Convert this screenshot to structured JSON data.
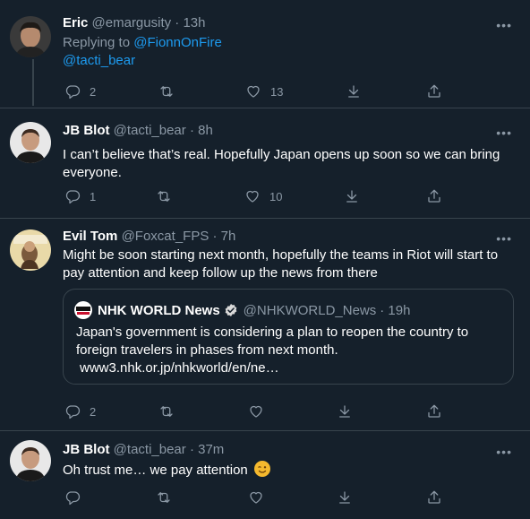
{
  "tweets": [
    {
      "name": "Eric",
      "handle": "@emargusity",
      "time": "· 13h",
      "replying_label": "Replying to",
      "replying_to_1": "@FionnOnFire",
      "replying_to_2": "@tacti_bear",
      "reply_count": "2",
      "retweet_count": "",
      "like_count": "13"
    },
    {
      "name": "JB Blot",
      "handle": "@tacti_bear",
      "time": "· 8h",
      "text": "I can’t believe that’s real.  Hopefully Japan opens up soon so we can bring everyone.",
      "reply_count": "1",
      "retweet_count": "",
      "like_count": "10"
    },
    {
      "name": "Evil Tom",
      "handle": "@Foxcat_FPS",
      "time": "· 7h",
      "text": "Might be soon starting next month, hopefully the teams in Riot will start to pay attention and keep follow up the news from there",
      "quote": {
        "logo_text": "NHK WORLD",
        "name": "NHK WORLD News",
        "handle": "@NHKWORLD_News",
        "time": "· 19h",
        "text": "Japan's government is considering a plan to reopen the country to foreign travelers in phases from next month.",
        "link": "www3.nhk.or.jp/nhkworld/en/ne…"
      },
      "reply_count": "2",
      "retweet_count": "",
      "like_count": ""
    },
    {
      "name": "JB Blot",
      "handle": "@tacti_bear",
      "time": "· 37m",
      "text": "Oh trust me… we pay attention",
      "emoji": "winking-face",
      "reply_count": "",
      "retweet_count": "",
      "like_count": ""
    }
  ],
  "more_label": "•••",
  "colors": {
    "background": "#15202b",
    "border": "#38444d",
    "link": "#1d9bf0",
    "muted": "#8b98a5",
    "verified": "#1d9bf0"
  }
}
